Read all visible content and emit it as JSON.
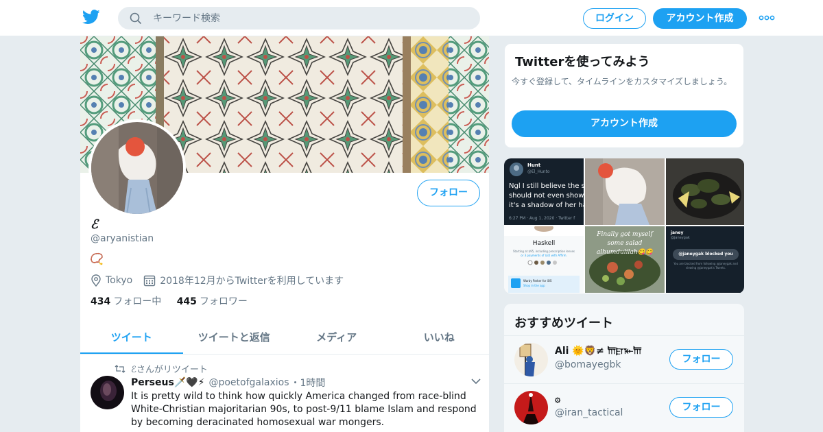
{
  "header": {
    "search_placeholder": "キーワード検索",
    "login_label": "ログイン",
    "signup_label": "アカウント作成",
    "brand_color": "#1da1f2"
  },
  "profile": {
    "name": "ℰ",
    "handle": "@aryanistian",
    "bio": "📿",
    "location": "Tokyo",
    "joined": "2018年12月からTwitterを利用しています",
    "follow_label": "フォロー",
    "following_count": "434",
    "following_label": "フォロー中",
    "followers_count": "445",
    "followers_label": "フォロワー",
    "tabs": [
      {
        "label": "ツイート",
        "active": true
      },
      {
        "label": "ツイートと返信",
        "active": false
      },
      {
        "label": "メディア",
        "active": false
      },
      {
        "label": "いいね",
        "active": false
      }
    ]
  },
  "tweet": {
    "retweet_label": "ℰさんがリツイート",
    "author_name": "Perseus🗡️🖤⚡",
    "author_handle": "@poetofgalaxios",
    "time": "・1時間",
    "text": "It is pretty wild to think how quickly America changed from race-blind White-Christian majoritarian 90s, to post-9/11 blame Islam and respond by becoming deracinated homosexual war mongers."
  },
  "signup_card": {
    "title": "Twitterを使ってみよう",
    "description": "今すぐ登録して、タイムラインをカスタマイズしましょう。",
    "button_label": "アカウント作成"
  },
  "media": {
    "tile1": {
      "name": "Hunt",
      "handle": "@El_Hunto",
      "text": "Ngl I still believe the sh should not even show i it's a shadow of her har",
      "meta": "6:27 PM · Aug 1, 2020 · Twitter f"
    },
    "tile4": {
      "title": "Haskell",
      "line": "Starting at $95, including prescription lenses",
      "line2": "or 3 payments of $32 with Affirm.",
      "brand": "Warby Parker for iOS",
      "sub": "Shop in the app"
    },
    "tile5": {
      "caption": "Finally got myself some salad alhumdulilah😋😋"
    },
    "tile6": {
      "name": "janey",
      "handle": "@janeygak",
      "pill": "@janeygak blocked you",
      "text": "You are blocked from following @janeygak and viewing @janeygak's Tweets."
    }
  },
  "recommended": {
    "title": "おすすめツイート",
    "follow_label": "フォロー",
    "accounts": [
      {
        "name": "Ali 🌞🦁≠ 𐎠𐎼𐎹𐎠",
        "handle": "@bomayegbk"
      },
      {
        "name": "۞",
        "handle": "@iran_tactical"
      }
    ]
  }
}
